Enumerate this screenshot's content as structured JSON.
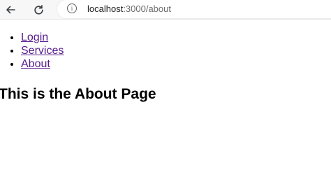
{
  "browser": {
    "url_host": "localhost",
    "url_path": ":3000/about"
  },
  "nav": {
    "items": [
      {
        "label": "Login"
      },
      {
        "label": "Services"
      },
      {
        "label": "About"
      }
    ]
  },
  "page": {
    "title": "This is the About Page"
  },
  "colors": {
    "link_visited": "#551a8b",
    "toolbar_bg": "#f7f7f7"
  },
  "icons": {
    "back": "back-arrow-icon",
    "reload": "reload-icon",
    "info": "info-icon"
  }
}
